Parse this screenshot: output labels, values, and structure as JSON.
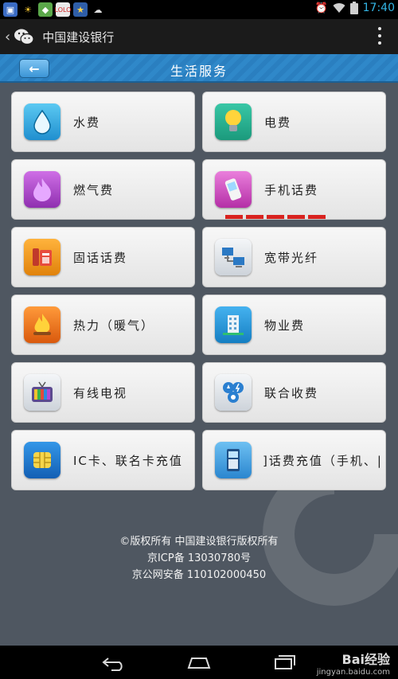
{
  "status_bar": {
    "time": "17:40",
    "left_icons": [
      "notification-app-icon",
      "sun-icon",
      "app-icon",
      "lolo-icon",
      "star-icon",
      "cat-icon"
    ],
    "right_icons": [
      "alarm-icon",
      "wifi-icon",
      "battery-icon"
    ]
  },
  "app_bar": {
    "back": "‹",
    "title": "中国建设银行"
  },
  "header": {
    "back_label": "←",
    "title": "生活服务"
  },
  "services": [
    {
      "label": "水费",
      "icon": "water-drop-icon",
      "color": "#25a7df"
    },
    {
      "label": "电费",
      "icon": "light-bulb-icon",
      "color": "#2ab497"
    },
    {
      "label": "燃气费",
      "icon": "gas-flame-icon",
      "color": "#b247cf"
    },
    {
      "label": "手机话费",
      "icon": "mobile-phone-icon",
      "color": "#d24bc0"
    },
    {
      "label": "固话话费",
      "icon": "landline-phone-icon",
      "color": "#f29a1b"
    },
    {
      "label": "宽带光纤",
      "icon": "network-computers-icon",
      "color": "#d9dde2"
    },
    {
      "label": "热力（暖气）",
      "icon": "fire-icon",
      "color": "#f07a1e"
    },
    {
      "label": "物业费",
      "icon": "building-icon",
      "color": "#1f98dc"
    },
    {
      "label": "有线电视",
      "icon": "tv-icon",
      "color": "#d9dde2"
    },
    {
      "label": "联合收费",
      "icon": "utilities-icon",
      "color": "#d9dde2"
    },
    {
      "label": "IC卡、联名卡充值",
      "icon": "chip-card-icon",
      "color": "#1d7fd1"
    },
    {
      "label": "]话费充值（手机、|",
      "icon": "phone-recharge-icon",
      "color": "#3fa7e6"
    }
  ],
  "footer": {
    "copyright": "©版权所有 中国建设银行版权所有",
    "icp": "京ICP备 13030780号",
    "security": "京公网安备 110102000450"
  },
  "watermark": {
    "brand": "Bai经验",
    "url": "jingyan.baidu.com"
  }
}
